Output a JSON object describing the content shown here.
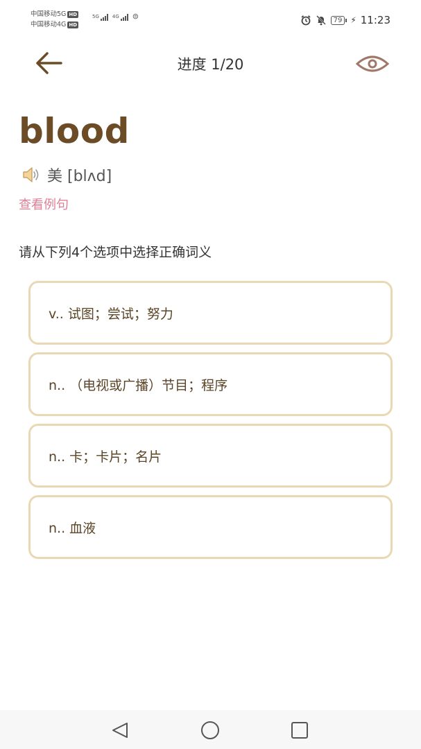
{
  "status_bar": {
    "carrier1": "中国移动5G",
    "carrier2": "中国移动4G",
    "hd_badge": "HD",
    "sig1_label": "5G",
    "sig2_label": "4G",
    "battery": "79",
    "time": "11:23"
  },
  "header": {
    "title": "进度 1/20",
    "back_icon": "arrow-left-icon",
    "eye_icon": "eye-icon"
  },
  "word": {
    "text": "blood",
    "phonetic": "美 [blʌd]",
    "speaker_icon": "speaker-icon",
    "example_link": "查看例句"
  },
  "quiz": {
    "instruction": "请从下列4个选项中选择正确词义",
    "options": [
      {
        "label": "v.. 试图；尝试；努力"
      },
      {
        "label": "n.. （电视或广播）节目；程序"
      },
      {
        "label": "n.. 卡；卡片；名片"
      },
      {
        "label": "n.. 血液"
      }
    ]
  },
  "colors": {
    "word": "#6b4c26",
    "option_border": "#ead8b4",
    "option_text": "#5a4425",
    "link": "#e07f95",
    "icon": "#6b4c26",
    "eye": "#a07868"
  }
}
